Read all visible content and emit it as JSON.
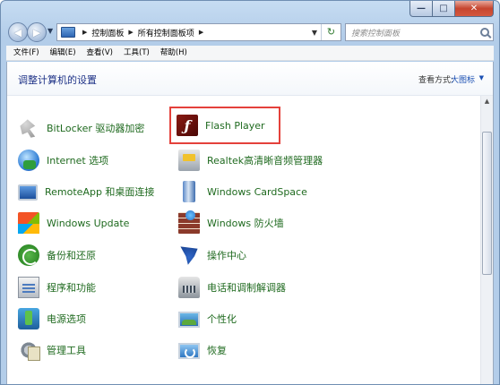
{
  "window": {
    "controls": {
      "minimize": "—",
      "maximize": "□",
      "close": "✕"
    }
  },
  "address": {
    "breadcrumbs": [
      "控制面板",
      "所有控制面板项"
    ],
    "search_placeholder": "搜索控制面板"
  },
  "menu": [
    "文件(F)",
    "编辑(E)",
    "查看(V)",
    "工具(T)",
    "帮助(H)"
  ],
  "content": {
    "title": "调整计算机的设置",
    "view_by_label": "查看方式:",
    "view_by_value": "大图标"
  },
  "items": [
    {
      "label": "BitLocker 驱动器加密",
      "icon": "bitlocker-icon"
    },
    {
      "label": "Flash Player",
      "icon": "flash-icon"
    },
    {
      "label": "Internet 选项",
      "icon": "internet-options-icon"
    },
    {
      "label": "Realtek高清晰音频管理器",
      "icon": "realtek-audio-icon"
    },
    {
      "label": "RemoteApp 和桌面连接",
      "icon": "remoteapp-icon"
    },
    {
      "label": "Windows CardSpace",
      "icon": "cardspace-icon"
    },
    {
      "label": "Windows Update",
      "icon": "windows-update-icon"
    },
    {
      "label": "Windows 防火墙",
      "icon": "firewall-icon"
    },
    {
      "label": "备份和还原",
      "icon": "backup-icon"
    },
    {
      "label": "操作中心",
      "icon": "action-center-icon"
    },
    {
      "label": "程序和功能",
      "icon": "programs-icon"
    },
    {
      "label": "电话和调制解调器",
      "icon": "phone-modem-icon"
    },
    {
      "label": "电源选项",
      "icon": "power-options-icon"
    },
    {
      "label": "个性化",
      "icon": "personalization-icon"
    },
    {
      "label": "管理工具",
      "icon": "admin-tools-icon"
    },
    {
      "label": "恢复",
      "icon": "recovery-icon"
    }
  ],
  "colors": {
    "item_text": "#1f6a1f",
    "title_text": "#1e3287",
    "highlight_border": "#e4413b"
  }
}
